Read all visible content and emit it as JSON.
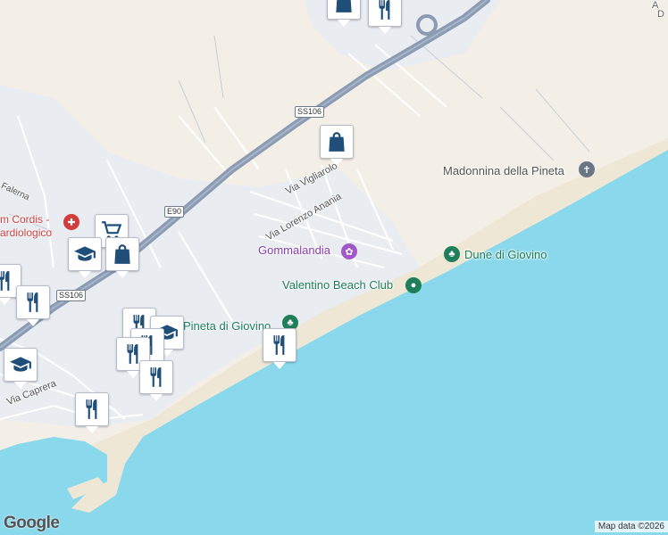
{
  "map": {
    "colors": {
      "land": "#f3efe6",
      "sea": "#8ad8ec",
      "beach": "#efe7d6",
      "urban": "#e9edf2",
      "highway": "#8b9bb4",
      "road": "#ffffff",
      "poi_label": "#8b3fae",
      "park_label": "#1e7f5a",
      "red_label": "#d23c3c",
      "icon_blue": "#1f4e79"
    },
    "labels": {
      "madonnina": "Madonnina della Pineta",
      "dune": "Dune di Giovino",
      "valentino": "Valentino Beach Club",
      "gommalandia": "Gommalandia",
      "pineta": "Pineta di Giovino",
      "via_vigliarolo": "Via Vigliarolo",
      "via_lorenzo_anania": "Via Lorenzo Anania",
      "via_caprera": "Via Caprera",
      "falerna": "Falerna",
      "cordis_line1": "m Cordis -",
      "cordis_line2": "ardiologico",
      "top_right_line1": "A",
      "top_right_line2": "D"
    },
    "road_shields": {
      "ss106_a": "SS106",
      "e90": "E90",
      "ss106_b": "SS106"
    },
    "markers": [
      {
        "name": "restaurant-marker-top",
        "icon": "fork-knife-icon"
      },
      {
        "name": "shopping-bag-marker-top",
        "icon": "shopping-bag-icon"
      },
      {
        "name": "shopping-bag-marker-via-vigliarolo",
        "icon": "shopping-bag-icon"
      },
      {
        "name": "shopping-cart-marker",
        "icon": "shopping-cart-icon"
      },
      {
        "name": "shopping-bag-marker-left",
        "icon": "shopping-bag-icon"
      },
      {
        "name": "school-marker-left",
        "icon": "graduation-cap-icon"
      },
      {
        "name": "restaurant-marker-left-1",
        "icon": "fork-knife-icon"
      },
      {
        "name": "restaurant-marker-left-2",
        "icon": "fork-knife-icon"
      },
      {
        "name": "restaurant-marker-center-1",
        "icon": "fork-knife-icon"
      },
      {
        "name": "school-marker-center",
        "icon": "graduation-cap-icon"
      },
      {
        "name": "restaurant-marker-center-2",
        "icon": "fork-knife-icon"
      },
      {
        "name": "restaurant-marker-center-3",
        "icon": "fork-knife-icon"
      },
      {
        "name": "restaurant-marker-center-4",
        "icon": "fork-knife-icon"
      },
      {
        "name": "restaurant-marker-pineta",
        "icon": "fork-knife-icon"
      },
      {
        "name": "school-marker-bottom-left",
        "icon": "graduation-cap-icon"
      },
      {
        "name": "restaurant-marker-bottom",
        "icon": "fork-knife-icon"
      }
    ],
    "attribution": "Map data ©2026",
    "logo": "Google"
  }
}
